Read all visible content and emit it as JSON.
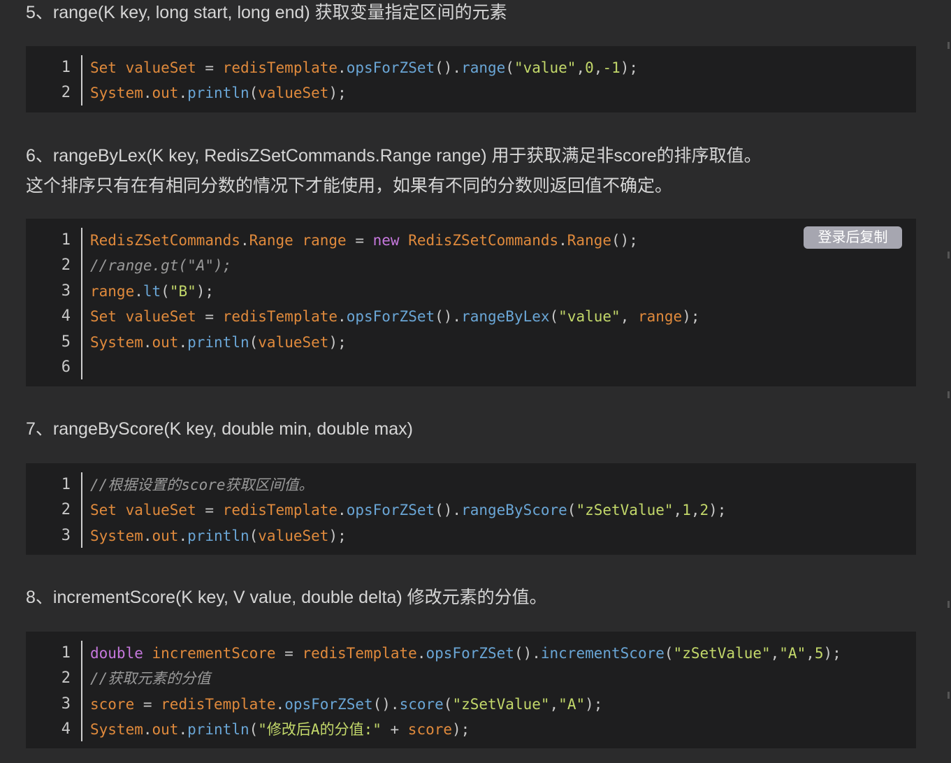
{
  "sections": [
    {
      "heading": "5、range(K key, long start, long end) 获取变量指定区间的元素",
      "lines": [
        [
          [
            "kw",
            "Set "
          ],
          [
            "var",
            "valueSet "
          ],
          [
            "pun",
            "= "
          ],
          [
            "var",
            "redisTemplate"
          ],
          [
            "pun",
            "."
          ],
          [
            "fn",
            "opsForZSet"
          ],
          [
            "pun",
            "()."
          ],
          [
            "fn",
            "range"
          ],
          [
            "pun",
            "("
          ],
          [
            "str",
            "\"value\""
          ],
          [
            "pun",
            ","
          ],
          [
            "num",
            "0"
          ],
          [
            "pun",
            ","
          ],
          [
            "num",
            "-1"
          ],
          [
            "pun",
            ");"
          ]
        ],
        [
          [
            "kw",
            "System"
          ],
          [
            "pun",
            "."
          ],
          [
            "var",
            "out"
          ],
          [
            "pun",
            "."
          ],
          [
            "fn",
            "println"
          ],
          [
            "pun",
            "("
          ],
          [
            "var",
            "valueSet"
          ],
          [
            "pun",
            ");"
          ]
        ]
      ]
    },
    {
      "heading": "6、rangeByLex(K key, RedisZSetCommands.Range range) 用于获取满足非score的排序取值。",
      "heading2": "这个排序只有在有相同分数的情况下才能使用，如果有不同的分数则返回值不确定。",
      "lines": [
        [
          [
            "kw",
            "RedisZSetCommands"
          ],
          [
            "pun",
            "."
          ],
          [
            "kw",
            "Range "
          ],
          [
            "var",
            "range "
          ],
          [
            "pun",
            "= "
          ],
          [
            "kw2",
            "new "
          ],
          [
            "kw",
            "RedisZSetCommands"
          ],
          [
            "pun",
            "."
          ],
          [
            "kw",
            "Range"
          ],
          [
            "pun",
            "();"
          ]
        ],
        [
          [
            "cmt",
            "//range.gt(\"A\");"
          ]
        ],
        [
          [
            "var",
            "range"
          ],
          [
            "pun",
            "."
          ],
          [
            "fn",
            "lt"
          ],
          [
            "pun",
            "("
          ],
          [
            "str",
            "\"B\""
          ],
          [
            "pun",
            ");"
          ]
        ],
        [
          [
            "kw",
            "Set "
          ],
          [
            "var",
            "valueSet "
          ],
          [
            "pun",
            "= "
          ],
          [
            "var",
            "redisTemplate"
          ],
          [
            "pun",
            "."
          ],
          [
            "fn",
            "opsForZSet"
          ],
          [
            "pun",
            "()."
          ],
          [
            "fn",
            "rangeByLex"
          ],
          [
            "pun",
            "("
          ],
          [
            "str",
            "\"value\""
          ],
          [
            "pun",
            ", "
          ],
          [
            "var",
            "range"
          ],
          [
            "pun",
            ");"
          ]
        ],
        [
          [
            "kw",
            "System"
          ],
          [
            "pun",
            "."
          ],
          [
            "var",
            "out"
          ],
          [
            "pun",
            "."
          ],
          [
            "fn",
            "println"
          ],
          [
            "pun",
            "("
          ],
          [
            "var",
            "valueSet"
          ],
          [
            "pun",
            ");"
          ]
        ],
        []
      ],
      "copy_label": "登录后复制"
    },
    {
      "heading": "7、rangeByScore(K key, double min, double max)",
      "lines": [
        [
          [
            "cmt",
            "//根据设置的score获取区间值。"
          ]
        ],
        [
          [
            "kw",
            "Set "
          ],
          [
            "var",
            "valueSet "
          ],
          [
            "pun",
            "= "
          ],
          [
            "var",
            "redisTemplate"
          ],
          [
            "pun",
            "."
          ],
          [
            "fn",
            "opsForZSet"
          ],
          [
            "pun",
            "()."
          ],
          [
            "fn",
            "rangeByScore"
          ],
          [
            "pun",
            "("
          ],
          [
            "str",
            "\"zSetValue\""
          ],
          [
            "pun",
            ","
          ],
          [
            "num",
            "1"
          ],
          [
            "pun",
            ","
          ],
          [
            "num",
            "2"
          ],
          [
            "pun",
            ");"
          ]
        ],
        [
          [
            "kw",
            "System"
          ],
          [
            "pun",
            "."
          ],
          [
            "var",
            "out"
          ],
          [
            "pun",
            "."
          ],
          [
            "fn",
            "println"
          ],
          [
            "pun",
            "("
          ],
          [
            "var",
            "valueSet"
          ],
          [
            "pun",
            ");"
          ]
        ]
      ]
    },
    {
      "heading": "8、incrementScore(K key, V value, double delta) 修改元素的分值。",
      "lines": [
        [
          [
            "kw2",
            "double "
          ],
          [
            "var",
            "incrementScore "
          ],
          [
            "pun",
            "= "
          ],
          [
            "var",
            "redisTemplate"
          ],
          [
            "pun",
            "."
          ],
          [
            "fn",
            "opsForZSet"
          ],
          [
            "pun",
            "()."
          ],
          [
            "fn",
            "incrementScore"
          ],
          [
            "pun",
            "("
          ],
          [
            "str",
            "\"zSetValue\""
          ],
          [
            "pun",
            ","
          ],
          [
            "str",
            "\"A\""
          ],
          [
            "pun",
            ","
          ],
          [
            "num",
            "5"
          ],
          [
            "pun",
            ");"
          ]
        ],
        [
          [
            "cmt",
            "//获取元素的分值"
          ]
        ],
        [
          [
            "var",
            "score "
          ],
          [
            "pun",
            "= "
          ],
          [
            "var",
            "redisTemplate"
          ],
          [
            "pun",
            "."
          ],
          [
            "fn",
            "opsForZSet"
          ],
          [
            "pun",
            "()."
          ],
          [
            "fn",
            "score"
          ],
          [
            "pun",
            "("
          ],
          [
            "str",
            "\"zSetValue\""
          ],
          [
            "pun",
            ","
          ],
          [
            "str",
            "\"A\""
          ],
          [
            "pun",
            ");"
          ]
        ],
        [
          [
            "kw",
            "System"
          ],
          [
            "pun",
            "."
          ],
          [
            "var",
            "out"
          ],
          [
            "pun",
            "."
          ],
          [
            "fn",
            "println"
          ],
          [
            "pun",
            "("
          ],
          [
            "str",
            "\"修改后A的分值:\" "
          ],
          [
            "pun",
            "+ "
          ],
          [
            "var",
            "score"
          ],
          [
            "pun",
            ");"
          ]
        ]
      ]
    }
  ]
}
